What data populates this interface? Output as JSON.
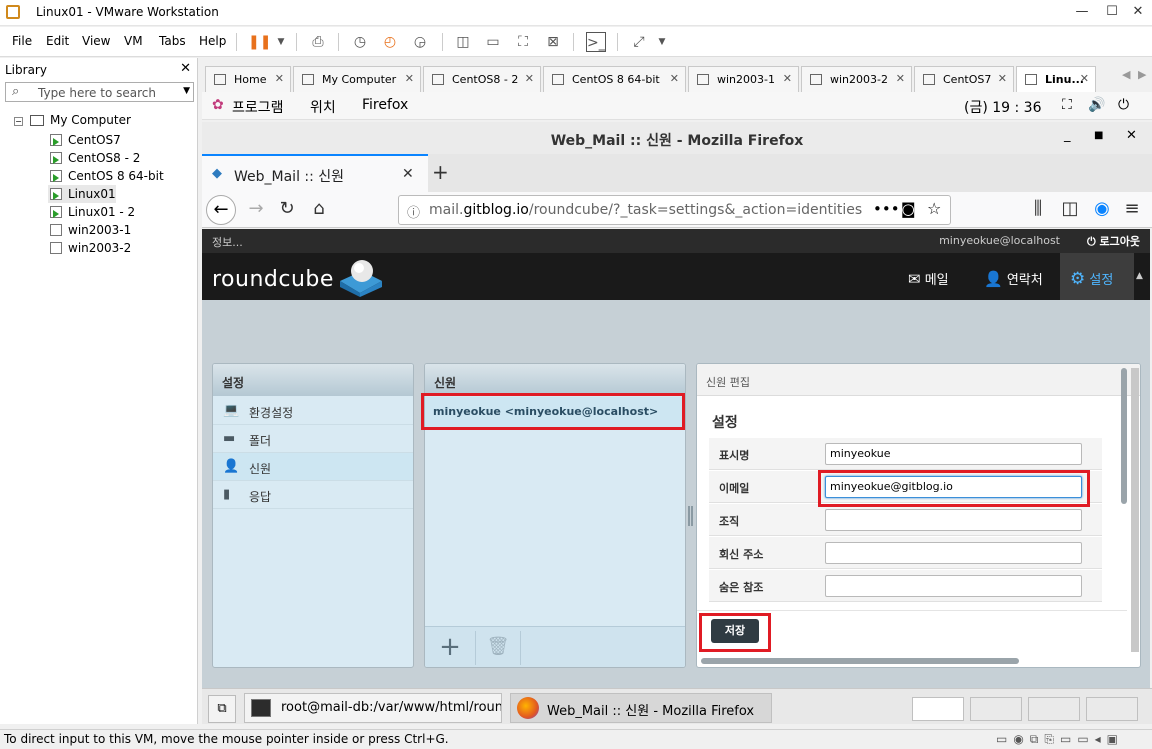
{
  "vmware": {
    "title": "Linux01 - VMware Workstation",
    "menu": [
      "File",
      "Edit",
      "View",
      "VM",
      "Tabs",
      "Help"
    ],
    "library": {
      "header": "Library",
      "search_placeholder": "Type here to search",
      "root": "My Computer",
      "items": [
        "CentOS7",
        "CentOS8 - 2",
        "CentOS 8 64-bit",
        "Linux01",
        "Linux01 - 2",
        "win2003-1",
        "win2003-2"
      ]
    },
    "tabs": [
      "Home",
      "My Computer",
      "CentOS8 - 2",
      "CentOS 8 64-bit",
      "win2003-1",
      "win2003-2",
      "CentOS7",
      "Linu..."
    ],
    "status_text": "To direct input to this VM, move the mouse pointer inside or press Ctrl+G."
  },
  "gnome": {
    "apps": "프로그램",
    "places": "위치",
    "firefox": "Firefox",
    "clock": "(금) 19 : 36"
  },
  "firefox": {
    "window_title": "Web_Mail :: 신원 - Mozilla Firefox",
    "tab_label": "Web_Mail :: 신원",
    "url_prefix": "mail.",
    "url_domain": "gitblog.io",
    "url_path": "/roundcube/?_task=settings&_action=identities"
  },
  "roundcube": {
    "about": "정보...",
    "user": "minyeokue@localhost",
    "logout": "로그아웃",
    "logo": "roundcube",
    "nav": {
      "mail": "메일",
      "contacts": "연락처",
      "settings": "설정"
    },
    "settings_panel": {
      "header": "설정",
      "items": [
        "환경설정",
        "폴더",
        "신원",
        "응답"
      ]
    },
    "identities_panel": {
      "header": "신원",
      "identity": "minyeokue <minyeokue@localhost>"
    },
    "edit_panel": {
      "header": "신원 편집",
      "section": "설정",
      "fields": {
        "name_label": "표시명",
        "name_value": "minyeokue",
        "email_label": "이메일",
        "email_value": "minyeokue@gitblog.io",
        "org_label": "조직",
        "org_value": "",
        "reply_label": "회신 주소",
        "reply_value": "",
        "bcc_label": "숨은 참조",
        "bcc_value": ""
      },
      "save": "저장"
    }
  },
  "guest_taskbar": {
    "terminal": "root@mail-db:/var/www/html/roun…",
    "firefox": "Web_Mail :: 신원 - Mozilla Firefox"
  }
}
